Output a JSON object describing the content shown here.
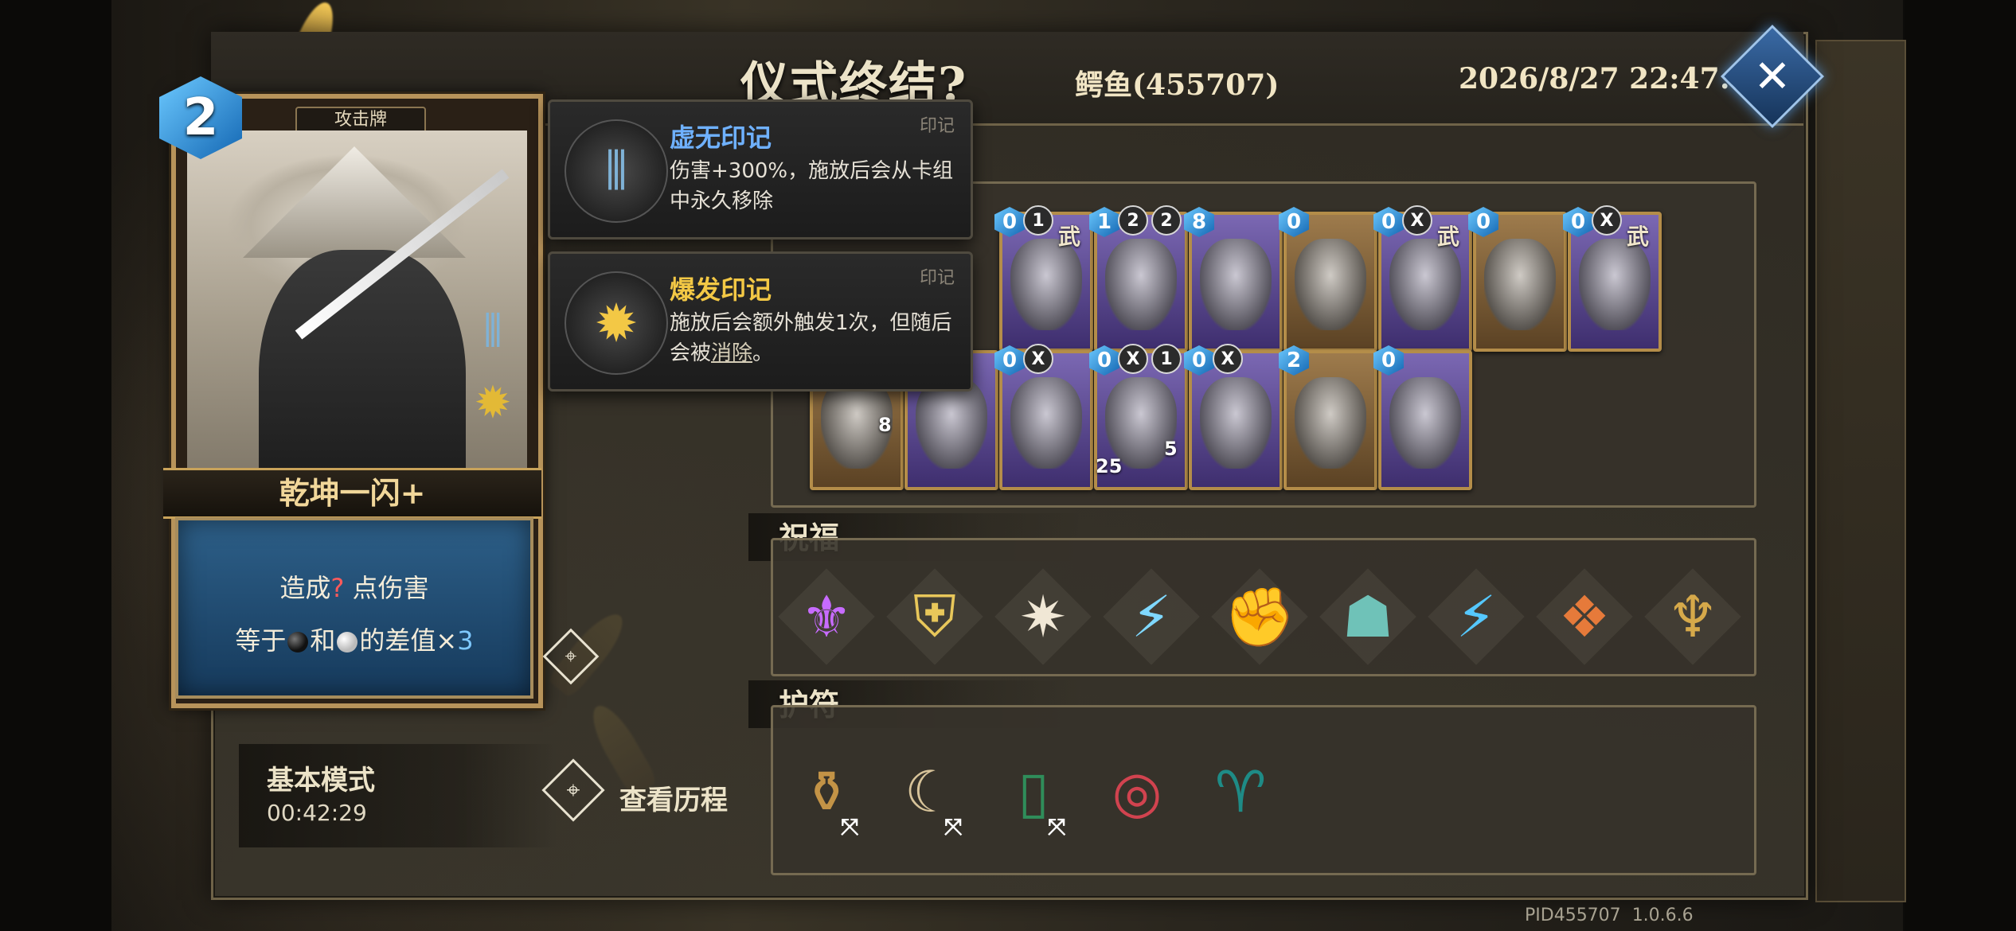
{
  "header": {
    "title": "仪式终结?",
    "player": "鳄鱼(455707)",
    "timestamp": "2026/8/27 22:47:32",
    "close_icon": "close-x-icon"
  },
  "selected_card": {
    "cost": "2",
    "type_label": "攻击牌",
    "name": "乾坤一闪+",
    "desc_line1_pre": "造成",
    "desc_line1_q": "?",
    "desc_line1_post": " 点伤害",
    "desc_line2_pre": "等于",
    "desc_line2_mid": "和",
    "desc_line2_post": "的差值×",
    "desc_line2_num": "3",
    "marks": [
      "void-mark-icon",
      "burst-mark-icon"
    ]
  },
  "tooltips": [
    {
      "title": "虚无印记",
      "tag": "印记",
      "text": "伤害+300%，施放后会从卡组中永久移除",
      "title_color": "#6fb1ff",
      "icon": "void-mark-icon"
    },
    {
      "title": "爆发印记",
      "tag": "印记",
      "text_pre": "施放后会额外触发1次，但随后会被",
      "text_link": "消除",
      "text_post": "。",
      "title_color": "#f3c845",
      "icon": "burst-mark-icon"
    }
  ],
  "deck": {
    "row1": [
      {
        "cost": "0",
        "badge": "1",
        "wu": "武",
        "color": "purple",
        "icon": "fist-art-icon"
      },
      {
        "cost": "1",
        "badge": "2",
        "badge2": "2",
        "color": "purple",
        "icon": "vessel-art-icon"
      },
      {
        "cost": "8",
        "color": "purple",
        "icon": "spear-art-icon"
      },
      {
        "cost": "0",
        "color": "brown",
        "icon": "feather-art-icon"
      },
      {
        "cost": "0",
        "badge": "X",
        "wu": "武",
        "color": "purple",
        "icon": "cloak-art-icon"
      },
      {
        "cost": "0",
        "color": "brown",
        "icon": "book-art-icon"
      },
      {
        "cost": "0",
        "badge": "X",
        "wu": "武",
        "color": "purple",
        "icon": "shadow-art-icon"
      }
    ],
    "row2": [
      {
        "corner": "8",
        "color": "brown",
        "icon": "sword-art-icon"
      },
      {
        "color": "purple",
        "icon": "gourd-art-icon"
      },
      {
        "cost": "0",
        "badge": "X",
        "color": "purple",
        "icon": "monk-art-icon"
      },
      {
        "cost": "0",
        "badge": "X",
        "badge2": "1",
        "corner": "25",
        "corner2": "5",
        "color": "purple",
        "icon": "banner-art-icon"
      },
      {
        "cost": "0",
        "badge": "X",
        "color": "purple",
        "icon": "talisman-art-icon"
      },
      {
        "cost": "2",
        "color": "brown",
        "icon": "swordsman-art-icon"
      },
      {
        "cost": "0",
        "color": "purple",
        "icon": "smoke-art-icon"
      }
    ]
  },
  "blessings": {
    "label": "祝福",
    "items": [
      {
        "icon": "purple-trident-icon",
        "glyph": "⚜",
        "color": "#c76bff"
      },
      {
        "icon": "gold-shield-icon",
        "glyph": "⛨",
        "color": "#e8c75a"
      },
      {
        "icon": "shattered-square-icon",
        "glyph": "✷",
        "color": "#f0e7d5"
      },
      {
        "icon": "lightning-shield-icon",
        "glyph": "⚡",
        "color": "#7fd8ff"
      },
      {
        "icon": "flame-fist-icon",
        "glyph": "✊",
        "color": "#ff9a2e"
      },
      {
        "icon": "hooded-figure-icon",
        "glyph": "☗",
        "color": "#6fc2b8"
      },
      {
        "icon": "lightning-cards-icon",
        "glyph": "⚡",
        "color": "#55c8ff"
      },
      {
        "icon": "rune-scroll-icon",
        "glyph": "❖",
        "color": "#e67a3a"
      },
      {
        "icon": "golden-idol-icon",
        "glyph": "♆",
        "color": "#d6a94a"
      }
    ]
  },
  "amulets": {
    "label": "护符",
    "items": [
      {
        "icon": "gourd-amulet-icon",
        "glyph": "⚱",
        "color": "#c39346",
        "marked": true
      },
      {
        "icon": "horn-amulet-icon",
        "glyph": "☾",
        "color": "#d8c49a",
        "marked": true
      },
      {
        "icon": "jade-tablet-icon",
        "glyph": "▯",
        "color": "#2f8d5a",
        "marked": true
      },
      {
        "icon": "red-ring-icon",
        "glyph": "◎",
        "color": "#d1434f",
        "marked": false
      },
      {
        "icon": "tassel-charm-icon",
        "glyph": "♈",
        "color": "#1e8b86",
        "marked": false
      }
    ],
    "mark_glyph": "⤧"
  },
  "mode": {
    "name": "基本模式",
    "time": "00:42:29"
  },
  "history": {
    "label": "查看历程"
  },
  "footer": {
    "pid": "PID455707",
    "version": "1.0.6.6"
  }
}
